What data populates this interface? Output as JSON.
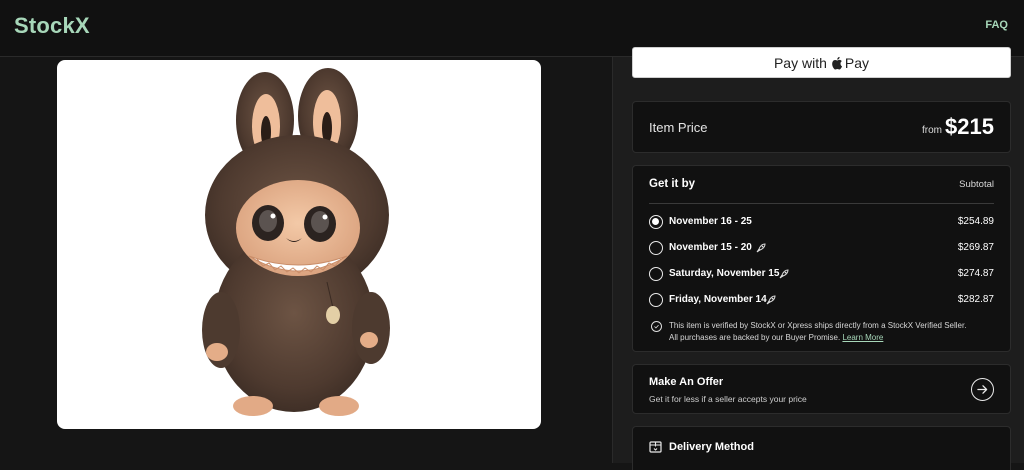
{
  "header": {
    "logo": "StockX",
    "faq_label": "FAQ"
  },
  "product": {
    "image_icon": "labubu-plush-figure"
  },
  "apple_pay": {
    "label_prefix": "Pay with",
    "label_suffix": "Pay"
  },
  "price": {
    "label": "Item Price",
    "from": "from",
    "value": "$215"
  },
  "get_it_by": {
    "title": "Get it by",
    "subtotal_label": "Subtotal",
    "options": [
      {
        "label": "November 16 - 25",
        "price": "$254.89",
        "selected": true,
        "express": false
      },
      {
        "label": "November 15 - 20",
        "price": "$269.87",
        "selected": false,
        "express": true
      },
      {
        "label": "Saturday, November 15",
        "price": "$274.87",
        "selected": false,
        "express": true
      },
      {
        "label": "Friday, November 14",
        "price": "$282.87",
        "selected": false,
        "express": true
      }
    ],
    "verify_line1": "This item is verified by StockX or Xpress ships directly from a StockX Verified Seller.",
    "verify_line2": "All purchases are backed by our Buyer Promise.",
    "learn_more": "Learn More"
  },
  "offer": {
    "title": "Make An Offer",
    "subtitle": "Get it for less if a seller accepts your price"
  },
  "delivery": {
    "title": "Delivery Method"
  },
  "colors": {
    "brand": "#a7d7b9",
    "background": "#151515",
    "card": "#111111"
  }
}
